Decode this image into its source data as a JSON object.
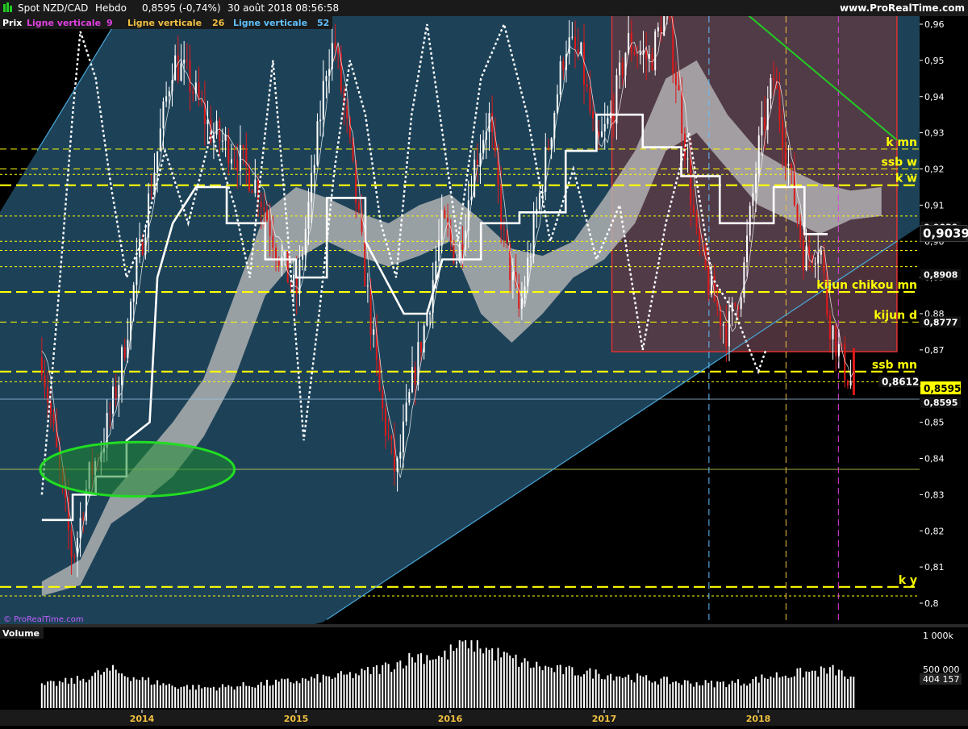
{
  "header": {
    "instrument": "Spot NZD/CAD",
    "timeframe": "Hebdo",
    "last_change": "0,8595 (-0,74%)",
    "datetime": "30 août 2018 08:56:58",
    "website": "www.ProRealTime.com"
  },
  "legend": {
    "price_label": "Prix",
    "indicators": [
      {
        "label": "Ligne verticale",
        "param": "9",
        "color": "#e040e0"
      },
      {
        "label": "Ligne verticale",
        "param": "26",
        "color": "#f0c040"
      },
      {
        "label": "Ligne verticale",
        "param": "52",
        "color": "#60c0ff"
      }
    ]
  },
  "watermark": "© ProRealTime.com",
  "colors": {
    "up_candle": "#ffffff",
    "down_candle": "#e01818",
    "level_lines": "#ffff00",
    "trend_channel_fill": "#1d4258",
    "channel_border": "#4aa8d8",
    "range_box_fill": "#5a3a44",
    "range_box_border": "#e03030",
    "cloud": "#b8b8b8",
    "highlight_ellipse": "#22dd22",
    "downtrend": "#22cc22",
    "volume_bars": "#ffffff",
    "price_badge": "#ffff00"
  },
  "chart_data": [
    {
      "type": "candlestick",
      "title": "Spot NZD/CAD",
      "x_ticks": [
        "2014",
        "2015",
        "2016",
        "2017",
        "2018"
      ],
      "y_ticks": [
        "0,96",
        "0,95",
        "0,94",
        "0,93",
        "0,92",
        "0,91",
        "0,90",
        "0,89",
        "0,88",
        "0,87",
        "0,86",
        "0,85",
        "0,84",
        "0,83",
        "0,82",
        "0,81",
        "0,8"
      ],
      "ylim": [
        0.7955,
        0.9655
      ],
      "last_price": 0.8595,
      "price_path": [
        [
          2013.35,
          0.868
        ],
        [
          2013.45,
          0.84
        ],
        [
          2013.55,
          0.812
        ],
        [
          2013.65,
          0.834
        ],
        [
          2013.75,
          0.845
        ],
        [
          2013.85,
          0.862
        ],
        [
          2013.95,
          0.888
        ],
        [
          2014.1,
          0.925
        ],
        [
          2014.2,
          0.95
        ],
        [
          2014.3,
          0.945
        ],
        [
          2014.45,
          0.93
        ],
        [
          2014.6,
          0.925
        ],
        [
          2014.75,
          0.915
        ],
        [
          2014.9,
          0.895
        ],
        [
          2015.0,
          0.885
        ],
        [
          2015.1,
          0.915
        ],
        [
          2015.2,
          0.95
        ],
        [
          2015.25,
          0.955
        ],
        [
          2015.35,
          0.925
        ],
        [
          2015.45,
          0.89
        ],
        [
          2015.55,
          0.855
        ],
        [
          2015.65,
          0.835
        ],
        [
          2015.75,
          0.86
        ],
        [
          2015.85,
          0.88
        ],
        [
          2015.95,
          0.905
        ],
        [
          2016.05,
          0.895
        ],
        [
          2016.15,
          0.92
        ],
        [
          2016.25,
          0.935
        ],
        [
          2016.35,
          0.9
        ],
        [
          2016.45,
          0.88
        ],
        [
          2016.55,
          0.905
        ],
        [
          2016.65,
          0.93
        ],
        [
          2016.75,
          0.955
        ],
        [
          2016.85,
          0.95
        ],
        [
          2016.95,
          0.925
        ],
        [
          2017.05,
          0.935
        ],
        [
          2017.15,
          0.955
        ],
        [
          2017.3,
          0.95
        ],
        [
          2017.4,
          0.965
        ],
        [
          2017.5,
          0.935
        ],
        [
          2017.6,
          0.9
        ],
        [
          2017.7,
          0.885
        ],
        [
          2017.8,
          0.875
        ],
        [
          2017.9,
          0.89
        ],
        [
          2018.0,
          0.925
        ],
        [
          2018.1,
          0.945
        ],
        [
          2018.2,
          0.92
        ],
        [
          2018.3,
          0.895
        ],
        [
          2018.4,
          0.9
        ],
        [
          2018.45,
          0.88
        ],
        [
          2018.55,
          0.866
        ],
        [
          2018.62,
          0.8595
        ]
      ],
      "chikou_path": [
        [
          2013.35,
          0.83
        ],
        [
          2013.45,
          0.88
        ],
        [
          2013.55,
          0.935
        ],
        [
          2013.6,
          0.958
        ],
        [
          2013.7,
          0.945
        ],
        [
          2013.8,
          0.915
        ],
        [
          2013.9,
          0.89
        ],
        [
          2014.0,
          0.9
        ],
        [
          2014.15,
          0.925
        ],
        [
          2014.3,
          0.905
        ],
        [
          2014.45,
          0.93
        ],
        [
          2014.6,
          0.91
        ],
        [
          2014.7,
          0.89
        ],
        [
          2014.8,
          0.93
        ],
        [
          2014.85,
          0.95
        ],
        [
          2014.95,
          0.9
        ],
        [
          2015.05,
          0.845
        ],
        [
          2015.15,
          0.88
        ],
        [
          2015.25,
          0.92
        ],
        [
          2015.35,
          0.95
        ],
        [
          2015.45,
          0.935
        ],
        [
          2015.55,
          0.905
        ],
        [
          2015.65,
          0.89
        ],
        [
          2015.75,
          0.935
        ],
        [
          2015.85,
          0.96
        ],
        [
          2015.95,
          0.93
        ],
        [
          2016.05,
          0.9
        ],
        [
          2016.2,
          0.945
        ],
        [
          2016.35,
          0.96
        ],
        [
          2016.5,
          0.935
        ],
        [
          2016.65,
          0.9
        ],
        [
          2016.8,
          0.92
        ],
        [
          2016.95,
          0.895
        ],
        [
          2017.1,
          0.91
        ],
        [
          2017.25,
          0.87
        ],
        [
          2017.4,
          0.905
        ],
        [
          2017.55,
          0.93
        ],
        [
          2017.7,
          0.89
        ],
        [
          2017.85,
          0.88
        ],
        [
          2018.0,
          0.864
        ],
        [
          2018.05,
          0.87
        ]
      ],
      "kijun_path": [
        [
          2013.35,
          0.823
        ],
        [
          2013.55,
          0.823
        ],
        [
          2013.55,
          0.83
        ],
        [
          2013.7,
          0.83
        ],
        [
          2013.7,
          0.835
        ],
        [
          2013.9,
          0.835
        ],
        [
          2013.9,
          0.845
        ],
        [
          2014.05,
          0.85
        ],
        [
          2014.1,
          0.89
        ],
        [
          2014.2,
          0.905
        ],
        [
          2014.35,
          0.915
        ],
        [
          2014.55,
          0.915
        ],
        [
          2014.55,
          0.905
        ],
        [
          2014.8,
          0.905
        ],
        [
          2014.8,
          0.895
        ],
        [
          2015.0,
          0.895
        ],
        [
          2015.0,
          0.89
        ],
        [
          2015.2,
          0.89
        ],
        [
          2015.2,
          0.912
        ],
        [
          2015.45,
          0.912
        ],
        [
          2015.45,
          0.9
        ],
        [
          2015.7,
          0.88
        ],
        [
          2015.85,
          0.88
        ],
        [
          2015.95,
          0.895
        ],
        [
          2016.2,
          0.895
        ],
        [
          2016.2,
          0.905
        ],
        [
          2016.45,
          0.905
        ],
        [
          2016.45,
          0.908
        ],
        [
          2016.75,
          0.908
        ],
        [
          2016.75,
          0.925
        ],
        [
          2016.95,
          0.925
        ],
        [
          2016.95,
          0.935
        ],
        [
          2017.25,
          0.935
        ],
        [
          2017.25,
          0.926
        ],
        [
          2017.5,
          0.926
        ],
        [
          2017.5,
          0.918
        ],
        [
          2017.75,
          0.918
        ],
        [
          2017.75,
          0.905
        ],
        [
          2018.1,
          0.905
        ],
        [
          2018.1,
          0.915
        ],
        [
          2018.3,
          0.915
        ],
        [
          2018.3,
          0.902
        ],
        [
          2018.45,
          0.902
        ]
      ],
      "cloud_band": [
        [
          2013.35,
          0.806,
          0.802
        ],
        [
          2013.6,
          0.812,
          0.805
        ],
        [
          2013.8,
          0.83,
          0.822
        ],
        [
          2014.0,
          0.84,
          0.828
        ],
        [
          2014.2,
          0.85,
          0.835
        ],
        [
          2014.4,
          0.862,
          0.846
        ],
        [
          2014.6,
          0.885,
          0.862
        ],
        [
          2014.8,
          0.908,
          0.885
        ],
        [
          2015.0,
          0.915,
          0.895
        ],
        [
          2015.2,
          0.912,
          0.9
        ],
        [
          2015.4,
          0.908,
          0.896
        ],
        [
          2015.6,
          0.905,
          0.893
        ],
        [
          2015.8,
          0.91,
          0.896
        ],
        [
          2016.0,
          0.913,
          0.9
        ],
        [
          2016.2,
          0.906,
          0.88
        ],
        [
          2016.4,
          0.898,
          0.872
        ],
        [
          2016.6,
          0.896,
          0.88
        ],
        [
          2016.8,
          0.9,
          0.89
        ],
        [
          2017.0,
          0.912,
          0.895
        ],
        [
          2017.2,
          0.925,
          0.905
        ],
        [
          2017.4,
          0.945,
          0.925
        ],
        [
          2017.6,
          0.95,
          0.93
        ],
        [
          2017.8,
          0.935,
          0.92
        ],
        [
          2018.0,
          0.925,
          0.91
        ],
        [
          2018.2,
          0.92,
          0.906
        ],
        [
          2018.4,
          0.916,
          0.902
        ],
        [
          2018.6,
          0.914,
          0.906
        ],
        [
          2018.8,
          0.915,
          0.907
        ]
      ],
      "horizontal_levels": [
        {
          "value": 0.9255,
          "style": "dashed",
          "label": "k mn"
        },
        {
          "value": 0.92,
          "style": "dashed",
          "label": "ssb w"
        },
        {
          "value": 0.9185,
          "style": "dotted",
          "label": ""
        },
        {
          "value": 0.9155,
          "style": "long-dash",
          "label": "k w"
        },
        {
          "value": 0.907,
          "style": "dotted",
          "label": ""
        },
        {
          "value": 0.9,
          "style": "dotted",
          "label": ""
        },
        {
          "value": 0.8975,
          "style": "dotted",
          "label": ""
        },
        {
          "value": 0.893,
          "style": "dotted",
          "label": ""
        },
        {
          "value": 0.886,
          "style": "long-dash",
          "label": "kijun chikou mn"
        },
        {
          "value": 0.8777,
          "style": "dashed",
          "label": "kijun d"
        },
        {
          "value": 0.864,
          "style": "long-dash",
          "label": "ssb mn"
        },
        {
          "value": 0.8612,
          "style": "dotted",
          "label": ""
        },
        {
          "value": 0.837,
          "style": "solid-thin",
          "label": ""
        },
        {
          "value": 0.8045,
          "style": "long-dash",
          "label": "k y"
        },
        {
          "value": 0.802,
          "style": "dotted",
          "label": ""
        }
      ],
      "price_badges": [
        {
          "value": 0.9039,
          "text": "0,9039",
          "style": "dark"
        },
        {
          "value": 0.9024,
          "text": "0,9039",
          "style": "big"
        },
        {
          "value": 0.8908,
          "text": "0,8908",
          "style": "dark"
        },
        {
          "value": 0.8777,
          "text": "0,8777",
          "style": "dark"
        },
        {
          "value": 0.8612,
          "text": "0,8612",
          "style": "dark-left"
        },
        {
          "value": 0.8595,
          "text": "0,8595",
          "style": "yellow"
        },
        {
          "value": 0.8555,
          "text": "0,8595",
          "style": "dark"
        }
      ],
      "vertical_markers": [
        {
          "x": 2017.68,
          "color": "#60c0ff"
        },
        {
          "x": 2018.18,
          "color": "#f0c040"
        },
        {
          "x": 2018.52,
          "color": "#e040e0"
        }
      ],
      "annotations": {
        "channel_lower": [
          [
            2015.2,
            0.7955
          ],
          [
            2018.9,
            0.9
          ]
        ],
        "channel_upper": [
          [
            2013.32,
            0.925
          ],
          [
            2013.9,
            0.9655
          ]
        ],
        "downtrend": [
          [
            2017.85,
            0.9655
          ],
          [
            2018.9,
            0.928
          ]
        ],
        "range_box": {
          "x0": 2017.05,
          "x1": 2018.9,
          "y0": 0.8695,
          "y1": 0.9655
        },
        "ellipse": {
          "cx": 2013.97,
          "cy": 0.837,
          "rx": 0.63,
          "ry": 0.0075
        }
      }
    },
    {
      "type": "bar",
      "title": "Volume",
      "y_ticks": [
        "1 000k",
        "500 000"
      ],
      "last_value": "404 157",
      "ylim": [
        0,
        1000000
      ],
      "volume_profile": [
        [
          2013.35,
          330000
        ],
        [
          2013.6,
          420000
        ],
        [
          2013.8,
          560000
        ],
        [
          2014.0,
          420000
        ],
        [
          2014.2,
          330000
        ],
        [
          2014.4,
          300000
        ],
        [
          2014.6,
          320000
        ],
        [
          2014.8,
          360000
        ],
        [
          2015.0,
          400000
        ],
        [
          2015.2,
          450000
        ],
        [
          2015.4,
          500000
        ],
        [
          2015.6,
          620000
        ],
        [
          2015.8,
          780000
        ],
        [
          2015.95,
          750000
        ],
        [
          2016.05,
          900000
        ],
        [
          2016.12,
          1000000
        ],
        [
          2016.3,
          800000
        ],
        [
          2016.5,
          650000
        ],
        [
          2016.7,
          560000
        ],
        [
          2016.9,
          520000
        ],
        [
          2017.1,
          480000
        ],
        [
          2017.3,
          420000
        ],
        [
          2017.5,
          380000
        ],
        [
          2017.7,
          360000
        ],
        [
          2017.9,
          380000
        ],
        [
          2018.1,
          480000
        ],
        [
          2018.3,
          520000
        ],
        [
          2018.5,
          560000
        ],
        [
          2018.62,
          404157
        ]
      ]
    }
  ]
}
